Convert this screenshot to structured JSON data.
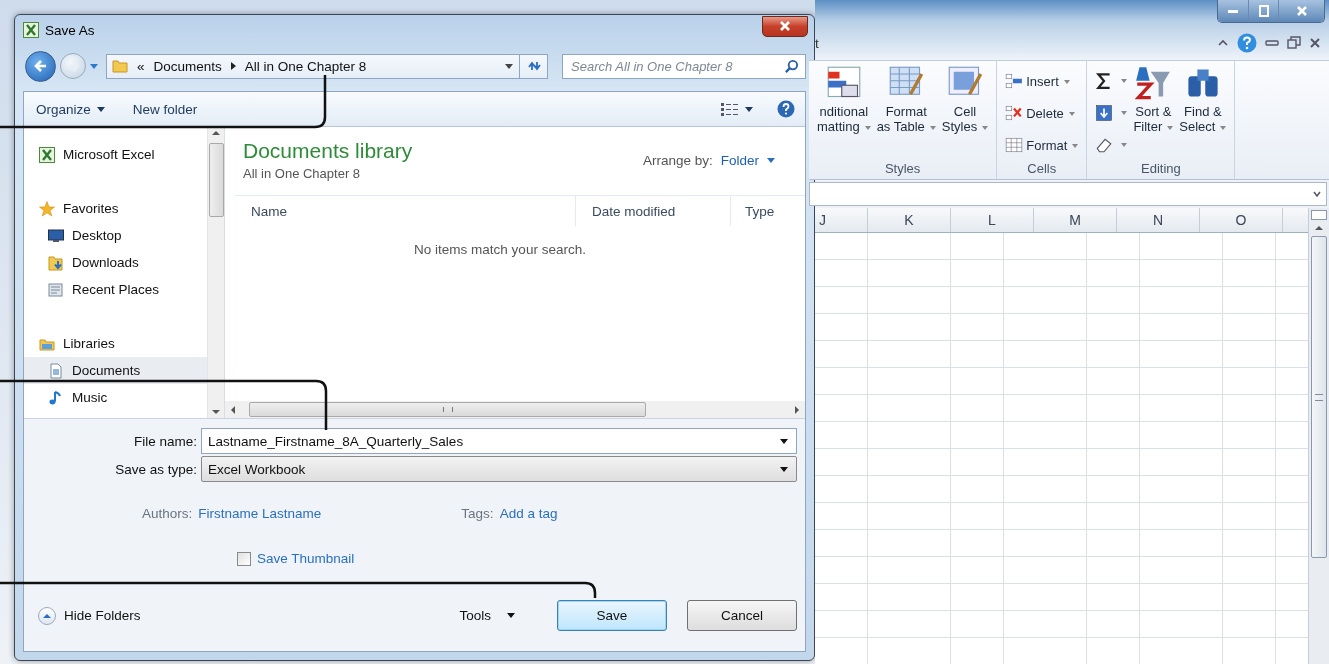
{
  "dialog": {
    "title": "Save As",
    "address": {
      "prefix": "«",
      "segments": [
        "Documents",
        "All in One Chapter 8"
      ]
    },
    "search": {
      "placeholder": "Search All in One Chapter 8"
    },
    "toolbar": [
      {
        "label": "Organize",
        "menu": true
      },
      {
        "label": "New folder",
        "menu": false
      }
    ],
    "nav": [
      {
        "label": "Microsoft Excel",
        "kind": "excel",
        "selected": false
      },
      {
        "label": "Favorites",
        "kind": "favorites",
        "selected": false,
        "children": [
          {
            "label": "Desktop",
            "kind": "desktop",
            "selected": false
          },
          {
            "label": "Downloads",
            "kind": "downloads",
            "selected": false
          },
          {
            "label": "Recent Places",
            "kind": "recent",
            "selected": false
          }
        ]
      },
      {
        "label": "Libraries",
        "kind": "libraries",
        "selected": false,
        "children": [
          {
            "label": "Documents",
            "kind": "document",
            "selected": true
          },
          {
            "label": "Music",
            "kind": "music",
            "selected": false
          }
        ]
      }
    ],
    "library": {
      "title": "Documents library",
      "subtitle": "All in One Chapter 8",
      "arrange_label": "Arrange by:",
      "arrange_value": "Folder"
    },
    "columns": [
      "Name",
      "Date modified",
      "Type"
    ],
    "empty_message": "No items match your search.",
    "fields": [
      {
        "label": "File name:",
        "value": "Lastname_Firstname_8A_Quarterly_Sales",
        "kind": "input"
      },
      {
        "label": "Save as type:",
        "value": "Excel Workbook",
        "kind": "select"
      }
    ],
    "meta": [
      {
        "label": "Authors:",
        "value": "Firstname Lastname"
      },
      {
        "label": "Tags:",
        "value": "Add a tag"
      }
    ],
    "thumbnail": {
      "label": "Save Thumbnail",
      "checked": false
    },
    "hide_folders": "Hide Folders",
    "tools": "Tools",
    "buttons": [
      {
        "label": "Save",
        "default": true
      },
      {
        "label": "Cancel",
        "default": false
      }
    ]
  },
  "excel": {
    "title_fragment": "t",
    "groups": [
      {
        "label": "Styles",
        "commands": [
          {
            "kind": "conditional",
            "lines": [
              "nditional",
              "matting"
            ],
            "menu": true
          },
          {
            "kind": "tablefmt",
            "lines": [
              "Format",
              "as Table"
            ],
            "menu": true
          },
          {
            "kind": "cellstyle",
            "lines": [
              "Cell",
              "Styles"
            ],
            "menu": true
          }
        ]
      },
      {
        "label": "Cells",
        "commands": [
          {
            "kind": "insert",
            "lines": [
              "Insert"
            ],
            "menu": true
          },
          {
            "kind": "delete",
            "lines": [
              "Delete"
            ],
            "menu": true
          },
          {
            "kind": "formatcells",
            "lines": [
              "Format"
            ],
            "menu": true
          }
        ]
      },
      {
        "label": "Editing",
        "commands": [
          {
            "kind": "autosum",
            "menu": true
          },
          {
            "kind": "fill",
            "menu": true
          },
          {
            "kind": "clear",
            "menu": true
          },
          {
            "kind": "sort",
            "lines": [
              "Sort &",
              "Filter"
            ],
            "menu": true
          },
          {
            "kind": "find",
            "lines": [
              "Find &",
              "Select"
            ],
            "menu": true
          }
        ]
      }
    ],
    "columns": [
      "J",
      "K",
      "L",
      "M",
      "N",
      "O"
    ]
  }
}
